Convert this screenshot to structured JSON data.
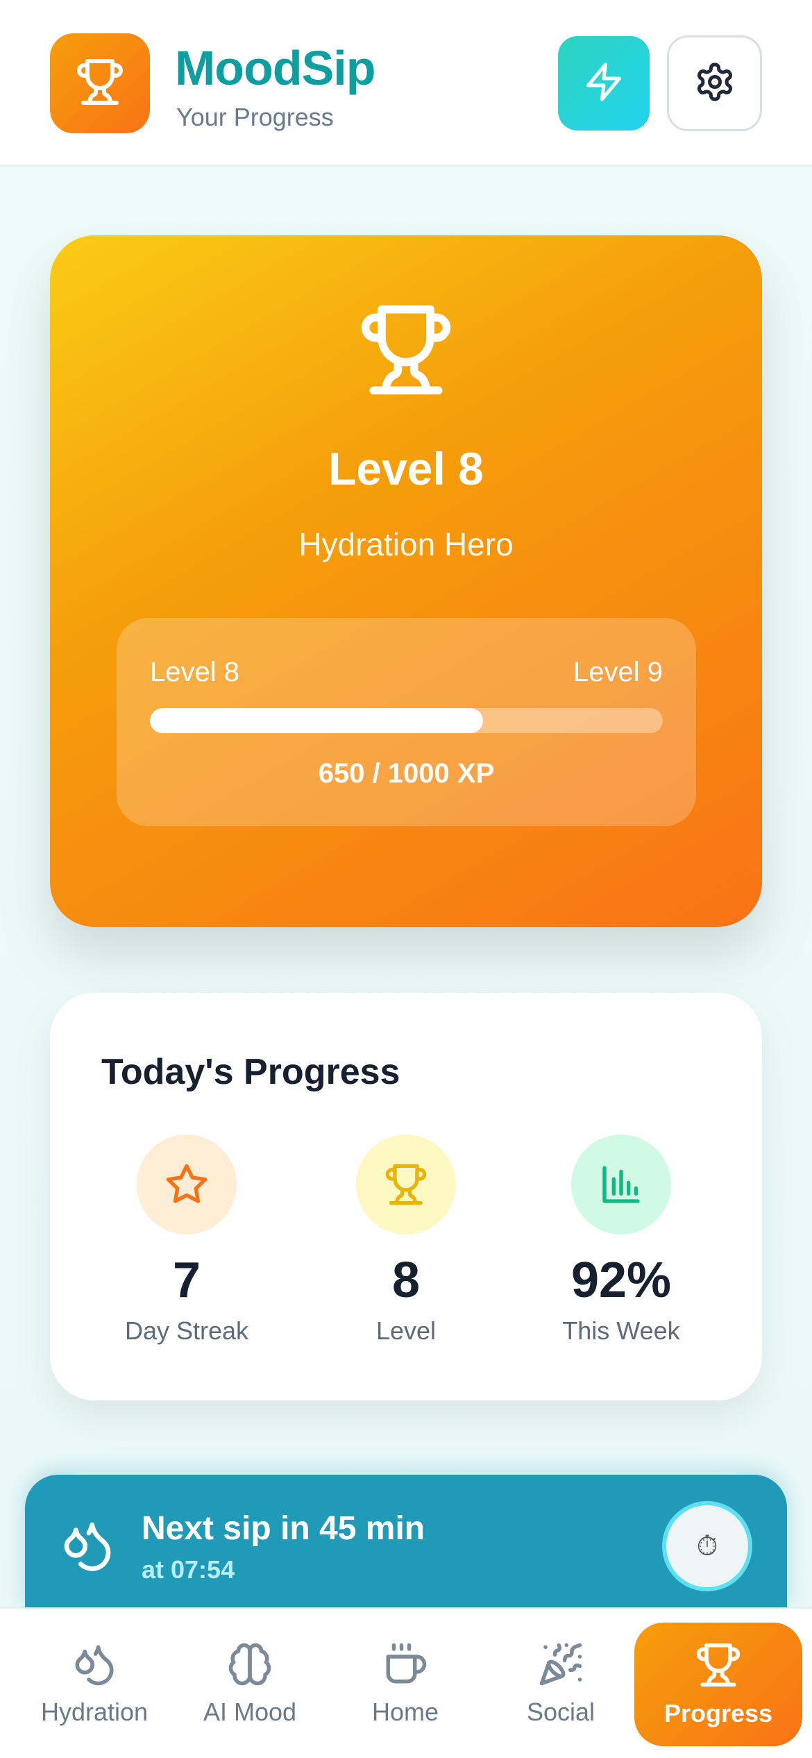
{
  "header": {
    "app_name": "MoodSip",
    "subtitle": "Your Progress",
    "logo_icon": "trophy-icon",
    "quick_action_icon": "lightning-icon",
    "settings_icon": "gear-icon"
  },
  "level_card": {
    "title": "Level 8",
    "rank": "Hydration Hero",
    "current_level_label": "Level 8",
    "next_level_label": "Level 9",
    "xp_text": "650 / 1000 XP",
    "xp_progress_fraction": 0.65
  },
  "today": {
    "title": "Today's Progress",
    "stats": [
      {
        "value": "7",
        "label": "Day Streak",
        "icon": "star-icon",
        "color": "#f97316",
        "bg": "#ffedd5"
      },
      {
        "value": "8",
        "label": "Level",
        "icon": "trophy-icon",
        "color": "#eab308",
        "bg": "#fef9c3"
      },
      {
        "value": "92%",
        "label": "This Week",
        "icon": "bar-chart-icon",
        "color": "#10b981",
        "bg": "#d1fae5"
      }
    ]
  },
  "reminder": {
    "title": "Next sip in 45 min",
    "time": "at 07:54",
    "timer_icon": "⏱"
  },
  "nav": {
    "items": [
      {
        "label": "Hydration",
        "icon": "droplets-icon"
      },
      {
        "label": "AI Mood",
        "icon": "brain-icon"
      },
      {
        "label": "Home",
        "icon": "coffee-cup-icon"
      },
      {
        "label": "Social",
        "icon": "party-popper-icon"
      },
      {
        "label": "Progress",
        "icon": "trophy-icon",
        "active": true
      }
    ]
  },
  "colors": {
    "brand_teal": "#0f9ea0",
    "accent_orange": "#f97316",
    "accent_amber": "#f59e0b"
  }
}
